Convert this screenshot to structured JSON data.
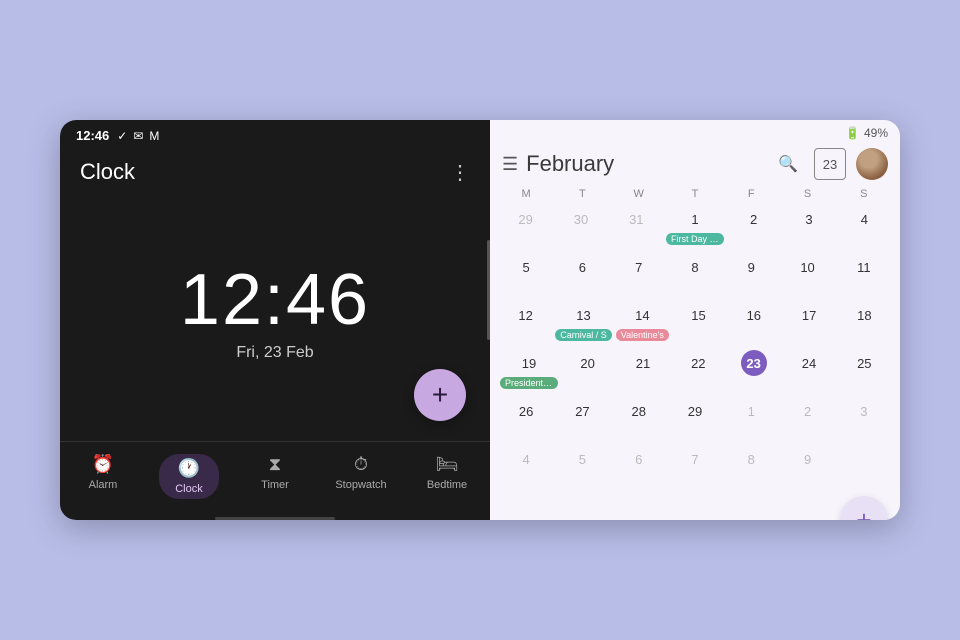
{
  "clock_app": {
    "status_time": "12:46",
    "status_icons": [
      "✓",
      "💬",
      "M"
    ],
    "title": "Clock",
    "menu_label": "⋮",
    "time": "12:46",
    "date": "Fri, 23 Feb",
    "fab_label": "+",
    "nav_items": [
      {
        "id": "alarm",
        "label": "Alarm",
        "icon": "🔔",
        "active": false
      },
      {
        "id": "clock",
        "label": "Clock",
        "icon": "🕐",
        "active": true
      },
      {
        "id": "timer",
        "label": "Timer",
        "icon": "⧗",
        "active": false
      },
      {
        "id": "stopwatch",
        "label": "Stopwatch",
        "icon": "⏱",
        "active": false
      },
      {
        "id": "bedtime",
        "label": "Bedtime",
        "icon": "🛏",
        "active": false
      }
    ]
  },
  "calendar_app": {
    "battery": "49%",
    "month_title": "February",
    "header_icons": {
      "search": "🔍",
      "today_num": "23",
      "menu": "☰"
    },
    "weekdays": [
      "M",
      "T",
      "W",
      "T",
      "F",
      "S",
      "S"
    ],
    "weeks": [
      [
        {
          "num": "29",
          "other": true,
          "events": []
        },
        {
          "num": "30",
          "other": true,
          "events": []
        },
        {
          "num": "31",
          "other": true,
          "events": []
        },
        {
          "num": "1",
          "other": false,
          "events": [
            {
              "label": "First Day o…",
              "color": "teal"
            }
          ]
        },
        {
          "num": "2",
          "other": false,
          "events": []
        },
        {
          "num": "3",
          "other": false,
          "events": []
        },
        {
          "num": "4",
          "other": false,
          "events": []
        }
      ],
      [
        {
          "num": "5",
          "other": false,
          "events": []
        },
        {
          "num": "6",
          "other": false,
          "events": []
        },
        {
          "num": "7",
          "other": false,
          "events": []
        },
        {
          "num": "8",
          "other": false,
          "events": []
        },
        {
          "num": "9",
          "other": false,
          "events": []
        },
        {
          "num": "10",
          "other": false,
          "events": []
        },
        {
          "num": "11",
          "other": false,
          "events": []
        }
      ],
      [
        {
          "num": "12",
          "other": false,
          "events": []
        },
        {
          "num": "13",
          "other": false,
          "events": [
            {
              "label": "Carnival / S",
              "color": "teal"
            }
          ]
        },
        {
          "num": "14",
          "other": false,
          "events": [
            {
              "label": "Valentine's",
              "color": "pink"
            }
          ]
        },
        {
          "num": "15",
          "other": false,
          "events": []
        },
        {
          "num": "16",
          "other": false,
          "events": []
        },
        {
          "num": "17",
          "other": false,
          "events": []
        },
        {
          "num": "18",
          "other": false,
          "events": []
        }
      ],
      [
        {
          "num": "19",
          "other": false,
          "events": [
            {
              "label": "Presidents'…",
              "color": "green"
            }
          ]
        },
        {
          "num": "20",
          "other": false,
          "events": []
        },
        {
          "num": "21",
          "other": false,
          "events": []
        },
        {
          "num": "22",
          "other": false,
          "events": []
        },
        {
          "num": "23",
          "other": false,
          "today": true,
          "events": []
        },
        {
          "num": "24",
          "other": false,
          "events": []
        },
        {
          "num": "25",
          "other": false,
          "events": []
        }
      ],
      [
        {
          "num": "26",
          "other": false,
          "events": []
        },
        {
          "num": "27",
          "other": false,
          "events": []
        },
        {
          "num": "28",
          "other": false,
          "events": []
        },
        {
          "num": "29",
          "other": false,
          "events": []
        },
        {
          "num": "1",
          "other": true,
          "events": []
        },
        {
          "num": "2",
          "other": true,
          "events": []
        },
        {
          "num": "3",
          "other": true,
          "events": []
        }
      ],
      [
        {
          "num": "4",
          "other": true,
          "events": []
        },
        {
          "num": "5",
          "other": true,
          "events": []
        },
        {
          "num": "6",
          "other": true,
          "events": []
        },
        {
          "num": "7",
          "other": true,
          "events": []
        },
        {
          "num": "8",
          "other": true,
          "events": []
        },
        {
          "num": "9",
          "other": true,
          "events": []
        },
        {
          "num": "",
          "other": true,
          "events": []
        }
      ]
    ],
    "fab_label": "+",
    "more_events": "...",
    "bottom_more": "..."
  }
}
